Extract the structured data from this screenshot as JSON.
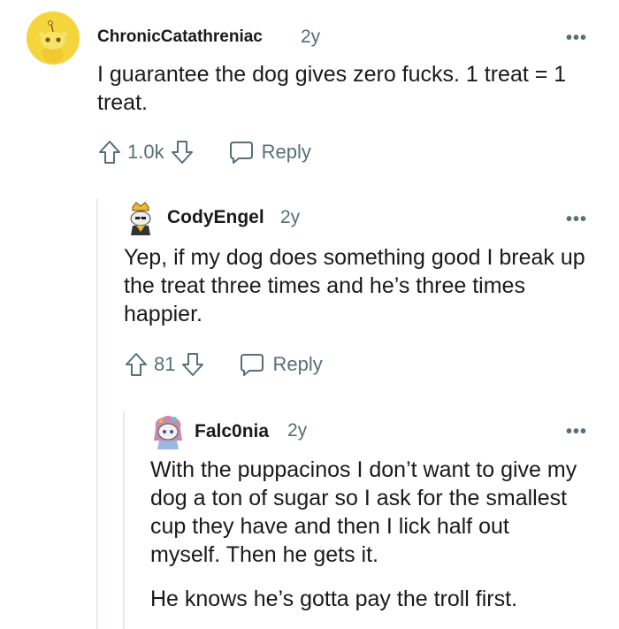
{
  "comments": [
    {
      "username": "ChronicCatathreniac",
      "age": "2y",
      "more": "•••",
      "body": [
        "I guarantee the dog gives zero fucks. 1 treat = 1 treat."
      ],
      "votes": "1.0k",
      "reply_label": "Reply",
      "avatar": "snoo-yellow-avatar"
    },
    {
      "username": "CodyEngel",
      "age": "2y",
      "more": "•••",
      "body": [
        "Yep, if my dog does something good I break up the treat three times and he’s three times happier."
      ],
      "votes": "81",
      "reply_label": "Reply",
      "avatar": "snoo-crowned-avatar"
    },
    {
      "username": "Falc0nia",
      "age": "2y",
      "more": "•••",
      "body": [
        "With the puppacinos I don’t want to give my dog a ton of sugar so I ask for the smallest cup they have and then I lick half out myself. Then he gets it.",
        "He knows he’s gotta pay the troll first."
      ],
      "avatar": "snoo-pink-avatar"
    }
  ],
  "colors": {
    "meta": "#576f76",
    "text": "#1a1a1b",
    "thread": "#e5ebee",
    "snoo_yellow": "#f5d53c"
  }
}
